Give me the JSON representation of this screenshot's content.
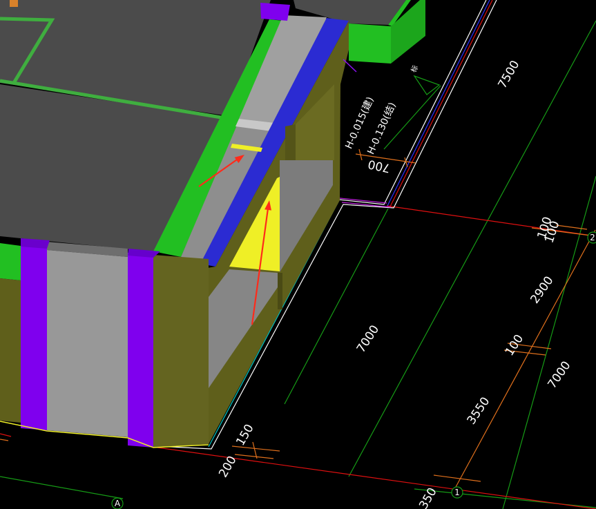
{
  "viewport": {
    "annotations": {
      "elevation_building": "H-0.015(建)",
      "elevation_structure": "H-0.130(结)",
      "elevation_mark": "标"
    },
    "dimensions": {
      "d7500": "7500",
      "d700": "700",
      "d100_top_a": "100",
      "d100_top_b": "100",
      "d2900": "2900",
      "d100_mid": "100",
      "d7000_right": "7000",
      "d7000_center": "7000",
      "d3550": "3550",
      "d150": "150",
      "d200": "200",
      "d350": "350"
    },
    "axis_bubbles": {
      "axis_1": "1",
      "axis_a": "A",
      "axis_2": "2"
    }
  },
  "colors": {
    "background": "#000000",
    "slab": "#4b4b4b",
    "slab_edge_green": "#22bf22",
    "beam_blue": "#2b2bd2",
    "beam_gray": "#8e8e8e",
    "wall_olive": "#5f5f1b",
    "column_purple": "#7f00ee",
    "highlight_yellow": "#efef26",
    "front_gray": "#989898",
    "arrow_red": "#ff2a1a",
    "dim_orange": "#e0701c",
    "grid_green": "#169c16",
    "axis_red": "#e01010",
    "outline_white": "#ffffff",
    "text_white": "#ffffff"
  }
}
